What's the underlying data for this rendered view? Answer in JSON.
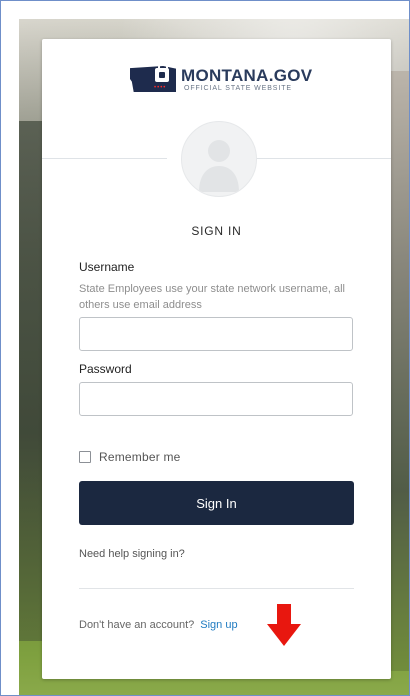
{
  "brand": {
    "title": "MONTANA.GOV",
    "subtitle": "OFFICIAL STATE WEBSITE",
    "logo_dots": "••••"
  },
  "form": {
    "heading": "SIGN IN",
    "username_label": "Username",
    "username_help": "State Employees use your state network username, all others use email address",
    "username_value": "",
    "password_label": "Password",
    "password_value": "",
    "remember_label": "Remember me",
    "remember_checked": false,
    "submit_label": "Sign In",
    "help_link": "Need help signing in?",
    "signup_prompt": "Don't have an account?",
    "signup_link": "Sign up"
  },
  "colors": {
    "button": "#1b2840",
    "link": "#1f7bc1",
    "annotation_arrow": "#e8170f"
  },
  "icons": {
    "avatar": "user-silhouette-icon",
    "annotation": "red-down-arrow-icon"
  }
}
